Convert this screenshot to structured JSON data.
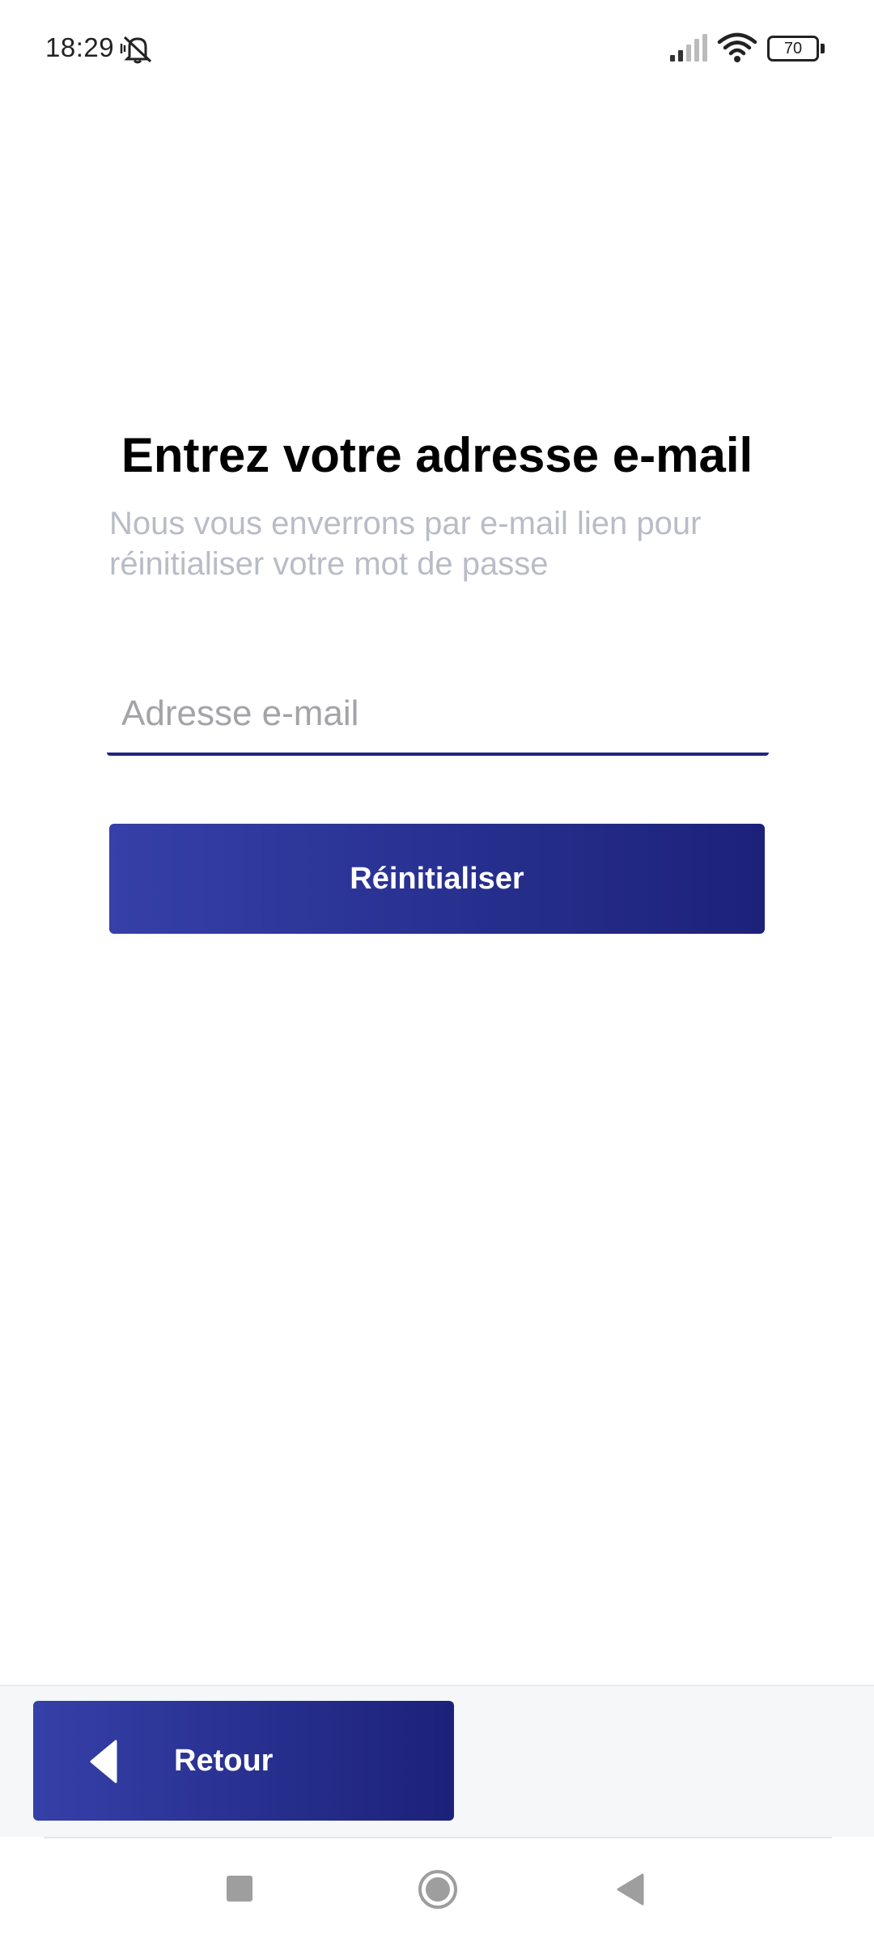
{
  "status_bar": {
    "time": "18:29",
    "battery_level": "70",
    "icons": [
      "mute-icon",
      "signal-icon",
      "wifi-icon",
      "battery-icon"
    ]
  },
  "main": {
    "title": "Entrez votre adresse e-mail",
    "subtitle": "Nous vous enverrons par e-mail lien pour réinitialiser votre mot de passe",
    "email_placeholder": "Adresse e-mail",
    "email_value": "",
    "reset_label": "Réinitialiser"
  },
  "bottom_bar": {
    "back_label": "Retour"
  },
  "colors": {
    "accent_start": "#3540a8",
    "accent_end": "#1c227a",
    "subtitle": "#b9bcc7",
    "placeholder": "#a3a3a8"
  },
  "nav_bar": {
    "icons": [
      "recents-icon",
      "home-icon",
      "back-nav-icon"
    ]
  }
}
